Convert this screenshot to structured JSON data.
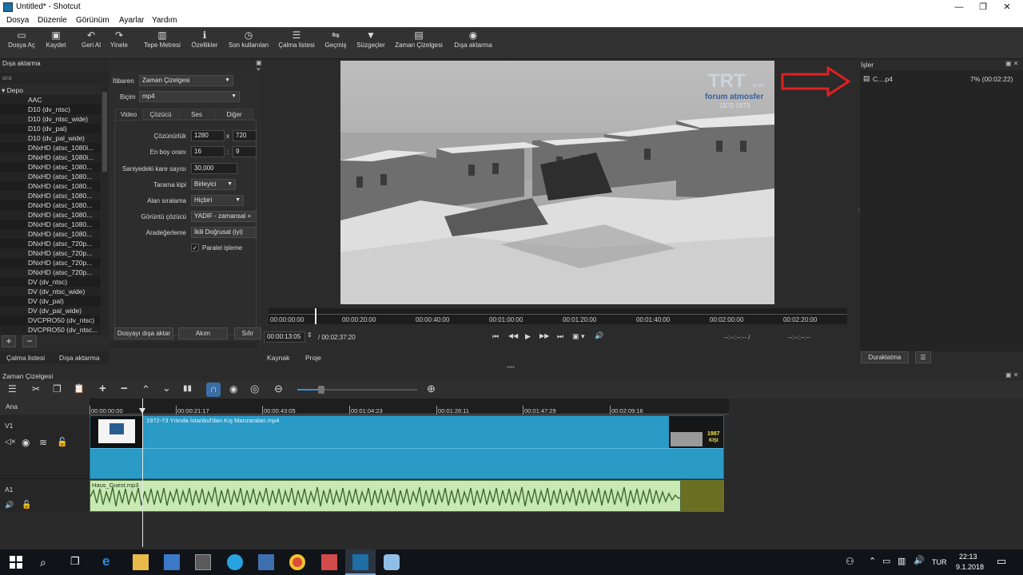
{
  "window": {
    "title": "Untitled* - Shotcut",
    "minimize": "—",
    "maximize": "❐",
    "close": "✕"
  },
  "menu": [
    "Dosya",
    "Düzenle",
    "Görünüm",
    "Ayarlar",
    "Yardım"
  ],
  "toolbar": [
    {
      "icon": "open-file-icon",
      "glyph": "▭",
      "label": "Dosya Aç"
    },
    {
      "icon": "save-icon",
      "glyph": "▣",
      "label": "Kaydet"
    },
    {
      "icon": "undo-icon",
      "glyph": "↶",
      "label": "Geri Al"
    },
    {
      "icon": "redo-icon",
      "glyph": "↷",
      "label": "Yinele"
    },
    {
      "icon": "peak-meter-icon",
      "glyph": "▥",
      "label": "Tepe Metresi"
    },
    {
      "icon": "info-icon",
      "glyph": "ℹ",
      "label": "Özellikler"
    },
    {
      "icon": "clock-icon",
      "glyph": "◷",
      "label": "Son kullanılan"
    },
    {
      "icon": "list-icon",
      "glyph": "☰",
      "label": "Çalma listesi"
    },
    {
      "icon": "history-icon",
      "glyph": "⇋",
      "label": "Geçmiş"
    },
    {
      "icon": "filter-icon",
      "glyph": "▼",
      "label": "Süzgeçler"
    },
    {
      "icon": "timeline-icon",
      "glyph": "▤",
      "label": "Zaman Çizelgesi"
    },
    {
      "icon": "export-icon",
      "glyph": "◉",
      "label": "Dışa aktarma"
    }
  ],
  "export_panel": {
    "title": "Dışa aktarma",
    "search_placeholder": "ara",
    "presets": [
      "Depo",
      "AAC",
      "D10 (dv_ntsc)",
      "D10 (dv_ntsc_wide)",
      "D10 (dv_pal)",
      "D10 (dv_pal_wide)",
      "DNxHD (atsc_1080i...",
      "DNxHD (atsc_1080i...",
      "DNxHD (atsc_1080...",
      "DNxHD (atsc_1080...",
      "DNxHD (atsc_1080...",
      "DNxHD (atsc_1080...",
      "DNxHD (atsc_1080...",
      "DNxHD (atsc_1080...",
      "DNxHD (atsc_1080...",
      "DNxHD (atsc_1080...",
      "DNxHD (atsc_720p...",
      "DNxHD (atsc_720p...",
      "DNxHD (atsc_720p...",
      "DNxHD (atsc_720p...",
      "DV (dv_ntsc)",
      "DV (dv_ntsc_wide)",
      "DV (dv_pal)",
      "DV (dv_pal_wide)",
      "DVCPRO50 (dv_ntsc)",
      "DVCPRO50 (dv_ntsc..."
    ],
    "from_label": "İtibaren",
    "from_value": "Zaman Çizelgesi",
    "format_label": "Biçim",
    "format_value": "mp4",
    "tabs": [
      "Video",
      "Çözücü",
      "Ses",
      "Diğer"
    ],
    "resolution_label": "Çözünürlük",
    "res_w": "1280",
    "res_x": "x",
    "res_h": "720",
    "aspect_label": "En boy oranı",
    "aspect_w": "16",
    "aspect_sep": ":",
    "aspect_h": "9",
    "fps_label": "Saniyedeki kare sayısı",
    "fps_value": "30,000",
    "scan_label": "Tarama kipi",
    "scan_value": "Birleyici",
    "field_order_label": "Alan sıralama",
    "field_order_value": "Hiçbiri",
    "deinterlacer_label": "Görüntü çözücü",
    "deinterlacer_value": "YADIF - zamansal +",
    "interp_label": "Aradeğerleme",
    "interp_value": "İkili Doğrusal (iyi)",
    "parallel_label": "Paralel işleme",
    "parallel_check": "✓",
    "export_file_button": "Dosyayı dışa aktar",
    "stream_button": "Akım",
    "reset_button": "Sıfır",
    "add_button": "+",
    "remove_button": "−",
    "bottom_tabs": [
      "Çalma listesi",
      "Dışa aktarma"
    ]
  },
  "player": {
    "ruler_labels": [
      "00:00:00:00",
      "00:00:20:00",
      "00:00:40:00",
      "00:01:00:00",
      "00:01:20:00",
      "00:01:40:00",
      "00:02:00:00",
      "00:02:20:00"
    ],
    "current_time": "00:00:13:05",
    "total_time": "/ 00:02:37:20",
    "in_point": "--:--:--:-- /",
    "out_point": "--:--:--:--",
    "tabs": [
      "Kaynak",
      "Proje"
    ],
    "controls": [
      "⏮",
      "◀◀",
      "▶",
      "▶▶",
      "⏭",
      "▣ ▾",
      "🔊"
    ],
    "watermark_logo": "TRT",
    "watermark_small": "arşiv",
    "watermark_text": "forum atmosfer",
    "watermark_years": "1972-1973"
  },
  "jobs": {
    "title": "İşler",
    "job_name": "C....p4",
    "job_progress": "7% (00:02:22)",
    "pause_button": "Duraklatma",
    "menu_button": "☰",
    "arrow_color": "#e02020"
  },
  "timeline": {
    "title": "Zaman Çizelgesi",
    "toolbar_icons": [
      "menu-icon",
      "cut-icon",
      "copy-icon",
      "paste-icon",
      "append-icon",
      "remove-icon",
      "lift-icon",
      "overwrite-icon",
      "split-icon",
      "snap-icon",
      "scrub-icon",
      "ripple-icon",
      "zoom-out-icon",
      "zoom-in-icon"
    ],
    "toolbar_glyphs": [
      "☰",
      "✂",
      "❐",
      "📋",
      "+",
      "−",
      "⌃",
      "⌄",
      "▮▮",
      "∩",
      "◉",
      "◎",
      "⊖",
      "⊕"
    ],
    "scale_label": "Ana",
    "ruler_labels": [
      "00:00:00:00",
      "00:00:21:17",
      "00:00:43:05",
      "00:01:04:23",
      "00:01:26:11",
      "00:01:47:29",
      "00:02:09:16"
    ],
    "v1": {
      "name": "V1",
      "clip_title": "1972-73 Yılında İstanbul'dan Kış Manzaraları.mp4",
      "end_badge": "1987",
      "end_badge2": "KIŞI"
    },
    "a1": {
      "name": "A1",
      "clip_title": "Haus_Guest.mp3"
    },
    "colors": {
      "video_clip": "#2a9ac6",
      "audio_clip": "#c8e8b4",
      "audio_bg": "#6b6f24"
    }
  },
  "taskbar": {
    "language": "TUR",
    "time": "22:13",
    "date": "9.1.2018",
    "apps": [
      "start-icon",
      "search-icon",
      "task-view-icon",
      "edge-icon",
      "explorer-icon",
      "store-icon",
      "calculator-icon",
      "skype-icon",
      "remote-icon",
      "chrome-icon",
      "mail-icon",
      "shotcut-icon",
      "paint-icon"
    ]
  }
}
